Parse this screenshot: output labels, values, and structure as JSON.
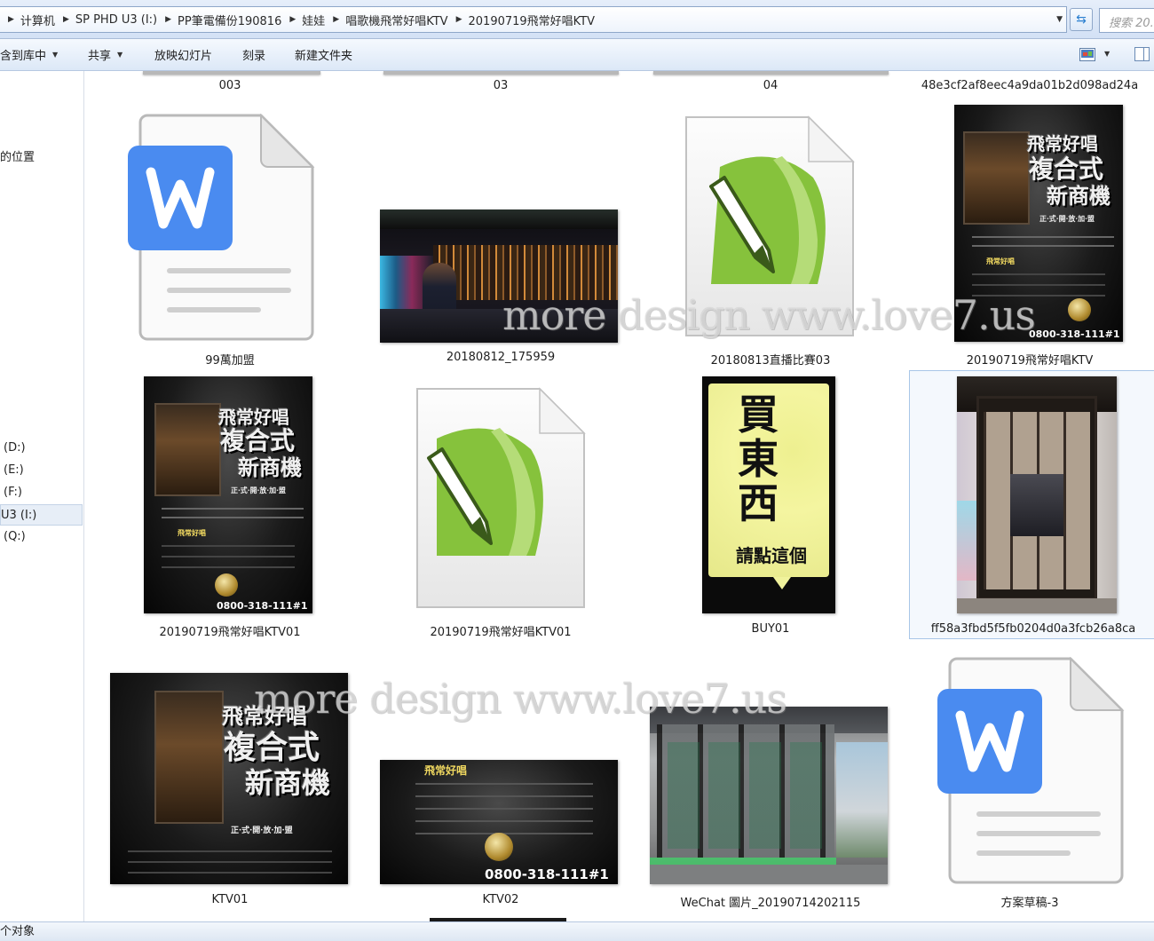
{
  "address": {
    "crumbs": [
      "计算机",
      "SP PHD U3 (I:)",
      "PP筆電備份190816",
      "娃娃",
      "唱歌機飛常好唱KTV",
      "20190719飛常好唱KTV"
    ],
    "search_placeholder": "搜索 20..."
  },
  "toolbar": {
    "include_label": "含到库中",
    "share_label": "共享",
    "slideshow_label": "放映幻灯片",
    "burn_label": "刻录",
    "newfolder_label": "新建文件夹"
  },
  "nav": {
    "locations_label": "的位置",
    "drives": [
      "(D:)",
      "(E:)",
      "(F:)",
      "U3 (I:)",
      "(Q:)"
    ],
    "selected_drive": "U3 (I:)"
  },
  "files": [
    {
      "name": "003",
      "kind": "cutoff"
    },
    {
      "name": "03",
      "kind": "cutoff"
    },
    {
      "name": "04",
      "kind": "cutoff"
    },
    {
      "name": "48e3cf2af8eec4a9da01b2d098ad24a",
      "kind": "cutoff"
    },
    {
      "name": "99萬加盟",
      "kind": "wps-doc"
    },
    {
      "name": "20180812_175959",
      "kind": "photo"
    },
    {
      "name": "20180813直播比賽03",
      "kind": "corel"
    },
    {
      "name": "20190719飛常好唱KTV",
      "kind": "poster"
    },
    {
      "name": "20190719飛常好唱KTV01",
      "kind": "poster"
    },
    {
      "name": "20190719飛常好唱KTV01",
      "kind": "corel"
    },
    {
      "name": "BUY01",
      "kind": "banner"
    },
    {
      "name": "ff58a3fbd5f5fb0204d0a3fcb26a8ca",
      "kind": "photo",
      "selected": true
    },
    {
      "name": "KTV01",
      "kind": "poster"
    },
    {
      "name": "KTV02",
      "kind": "poster-strip"
    },
    {
      "name": "WeChat 圖片_20190714202115",
      "kind": "photo"
    },
    {
      "name": "方案草稿-3",
      "kind": "wps-doc"
    }
  ],
  "poster_text": {
    "title_top": "飛常好唱",
    "title_mid": "複合式",
    "title_bot": "新商機",
    "subtitle": "正·式·開·放·加·盟",
    "brand_label": "飛常好唱",
    "phone": "0800-318-111#1"
  },
  "banner_text": {
    "main": "買東西",
    "sub": "請點這個"
  },
  "watermark": "more design www.love7.us",
  "status": {
    "count_label": "个对象"
  },
  "colors": {
    "wps_blue": "#4a8bf0",
    "corel_green": "#86c23c",
    "banner_yellow": "#f4f5a0",
    "selection": "#a8c6e8"
  }
}
